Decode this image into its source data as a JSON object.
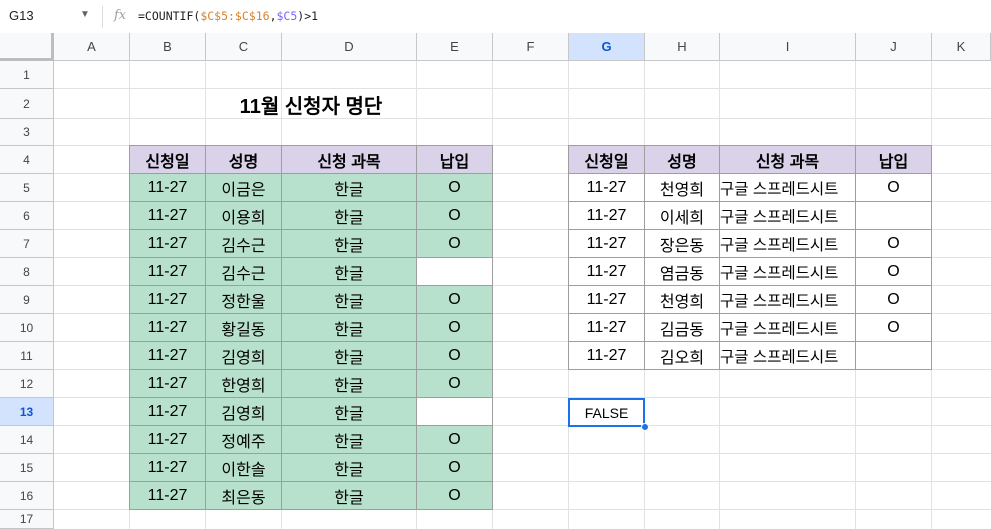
{
  "formula_bar": {
    "cell_ref": "G13",
    "fx": "fx",
    "formula_prefix": "=COUNTIF(",
    "formula_range": "$C$5:$C$16",
    "formula_comma": ",",
    "formula_crit": "$C5",
    "formula_suffix": ")>1"
  },
  "columns": [
    "A",
    "B",
    "C",
    "D",
    "E",
    "F",
    "G",
    "H",
    "I",
    "J",
    "K"
  ],
  "rows": [
    "1",
    "2",
    "3",
    "4",
    "5",
    "6",
    "7",
    "8",
    "9",
    "10",
    "11",
    "12",
    "13",
    "14",
    "15",
    "16",
    "17"
  ],
  "selected": {
    "column": "G",
    "row": "13",
    "value": "FALSE"
  },
  "title": "11월 신청자 명단",
  "left_table": {
    "headers": [
      "신청일",
      "성명",
      "신청 과목",
      "납입"
    ],
    "rows": [
      [
        "11-27",
        "이금은",
        "한글",
        "O"
      ],
      [
        "11-27",
        "이용희",
        "한글",
        "O"
      ],
      [
        "11-27",
        "김수근",
        "한글",
        "O"
      ],
      [
        "11-27",
        "김수근",
        "한글",
        ""
      ],
      [
        "11-27",
        "정한울",
        "한글",
        "O"
      ],
      [
        "11-27",
        "황길동",
        "한글",
        "O"
      ],
      [
        "11-27",
        "김영희",
        "한글",
        "O"
      ],
      [
        "11-27",
        "한영희",
        "한글",
        "O"
      ],
      [
        "11-27",
        "김영희",
        "한글",
        ""
      ],
      [
        "11-27",
        "정예주",
        "한글",
        "O"
      ],
      [
        "11-27",
        "이한솔",
        "한글",
        "O"
      ],
      [
        "11-27",
        "최은동",
        "한글",
        "O"
      ]
    ]
  },
  "right_table": {
    "headers": [
      "신청일",
      "성명",
      "신청 과목",
      "납입"
    ],
    "rows": [
      [
        "11-27",
        "천영희",
        "구글 스프레드시트",
        "O"
      ],
      [
        "11-27",
        "이세희",
        "구글 스프레드시트",
        ""
      ],
      [
        "11-27",
        "장은동",
        "구글 스프레드시트",
        "O"
      ],
      [
        "11-27",
        "염금동",
        "구글 스프레드시트",
        "O"
      ],
      [
        "11-27",
        "천영희",
        "구글 스프레드시트",
        "O"
      ],
      [
        "11-27",
        "김금동",
        "구글 스프레드시트",
        "O"
      ],
      [
        "11-27",
        "김오희",
        "구글 스프레드시트",
        ""
      ]
    ]
  }
}
